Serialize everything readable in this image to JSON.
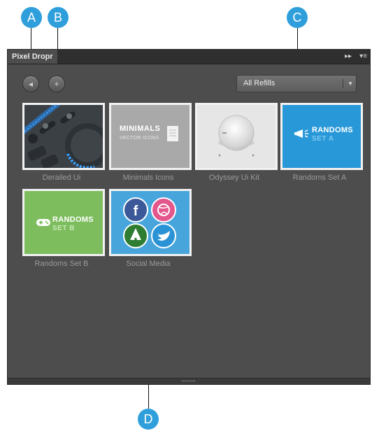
{
  "callouts": {
    "a": "A",
    "b": "B",
    "c": "C",
    "d": "D"
  },
  "panel": {
    "title": "Pixel Dropr",
    "header_controls": {
      "collapse": "▸▸",
      "menu": "▾≡"
    }
  },
  "toolbar": {
    "back_icon": "◂",
    "add_icon": "+"
  },
  "refills_dropdown": {
    "selected": "All Refills",
    "arrow": "▼"
  },
  "refills": [
    {
      "caption": "Derailed Ui"
    },
    {
      "caption": "Minimals Icons",
      "thumb_title": "MINIMALS",
      "thumb_subtitle": "VECTOR ICONS"
    },
    {
      "caption": "Odyssey Ui Kit"
    },
    {
      "caption": "Randoms Set A",
      "thumb_line1": "RANDOMS",
      "thumb_line2": "SET A"
    },
    {
      "caption": "Randoms Set B",
      "thumb_line1": "RANDOMS",
      "thumb_line2": "SET B"
    },
    {
      "caption": "Social Media"
    }
  ],
  "colors": {
    "callout": "#2f9fdc",
    "panel_bg": "#4d4d4d",
    "randoms_a_bg": "#2998d8",
    "randoms_b_bg": "#7dbd5e",
    "social_bg": "#47a5dc"
  }
}
